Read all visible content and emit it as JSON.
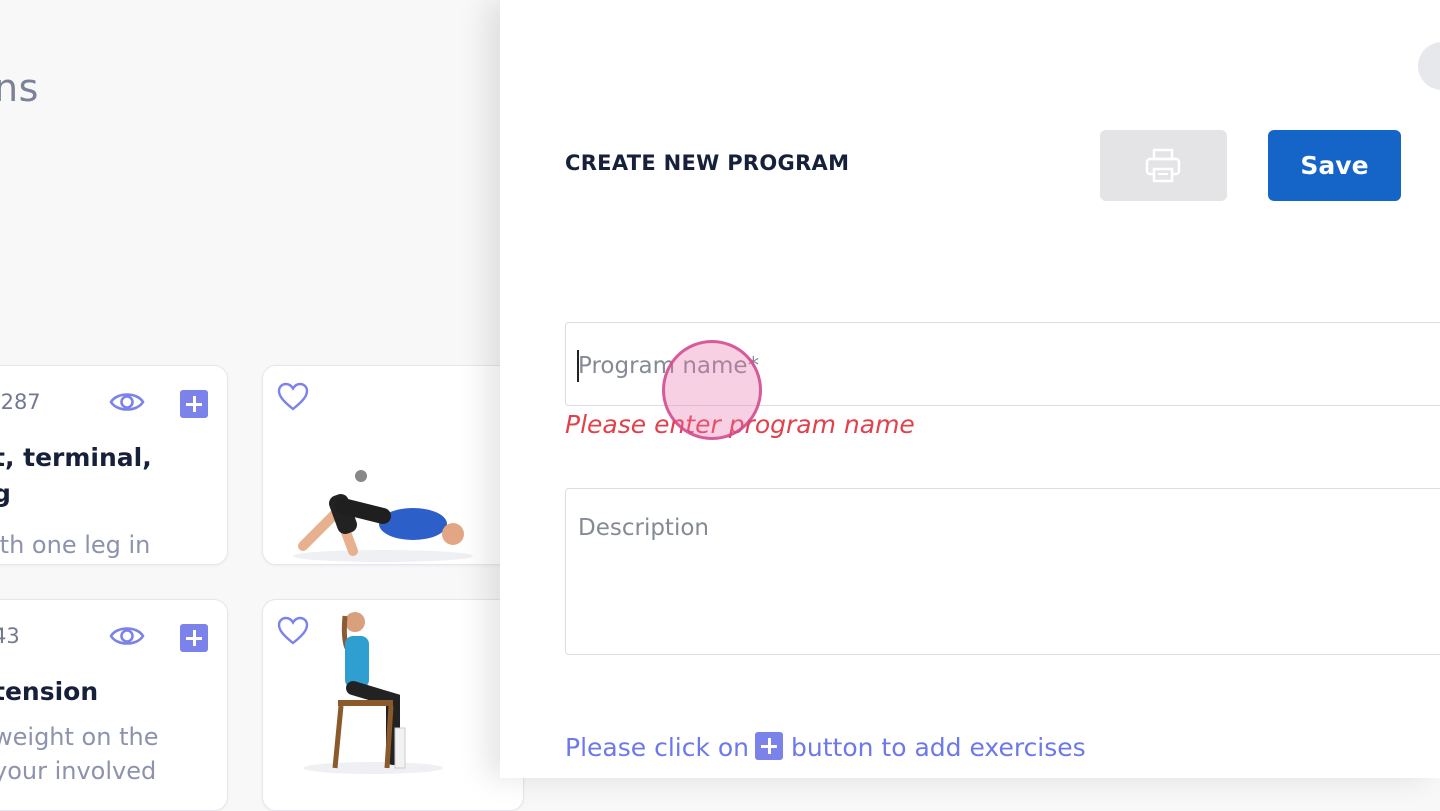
{
  "background": {
    "page_title_fragment": "ns",
    "cards": [
      {
        "id": "-287",
        "title": "t, terminal,\ng",
        "desc": "ith one leg in"
      },
      {
        "id": "43",
        "title": "tension",
        "desc": "weight on the\nyour involved"
      }
    ]
  },
  "panel": {
    "title": "CREATE NEW PROGRAM",
    "save_label": "Save",
    "program_name_placeholder": "Program name*",
    "program_name_value": "",
    "error_message": "Please enter program name",
    "description_placeholder": "Description",
    "description_value": "",
    "hint_before": "Please click on",
    "hint_after": "button to add exercises"
  },
  "colors": {
    "accent": "#7b83eb",
    "save_button": "#1565c8",
    "error": "#e2404b",
    "print_button_bg": "#e4e4e6"
  },
  "icons": [
    "eye-icon",
    "plus-icon",
    "heart-icon",
    "print-icon"
  ]
}
